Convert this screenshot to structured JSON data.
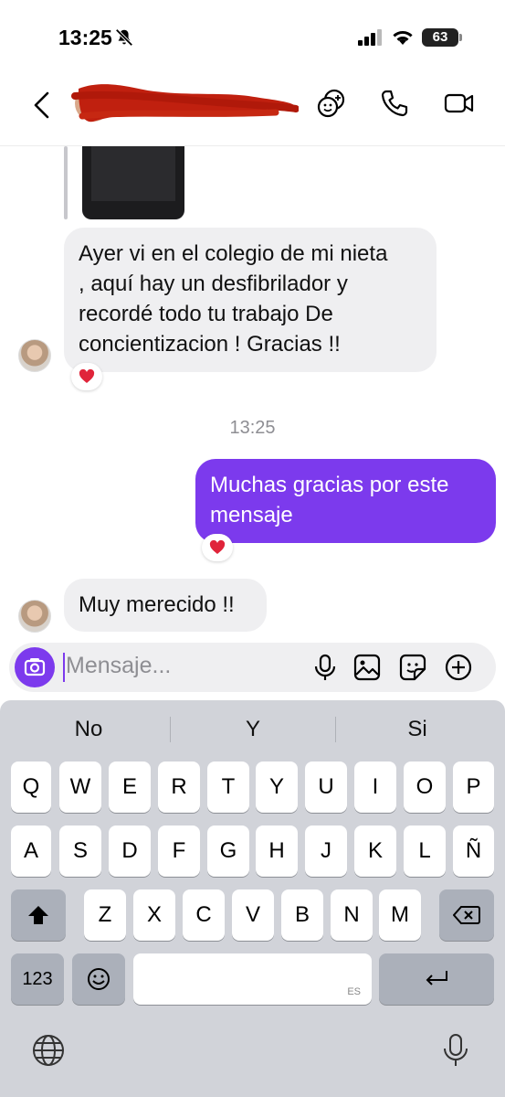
{
  "status_bar": {
    "time": "13:25",
    "battery": "63"
  },
  "header": {
    "contact_name": "",
    "icons": [
      "back-chevron-icon",
      "effects-icon",
      "phone-icon",
      "video-icon"
    ]
  },
  "messages": {
    "m1_lines": [
      "Ayer vi en el colegio de mi nieta",
      ", aquí hay un desfibrilador y",
      "recordé todo tu trabajo  De",
      "concientizacion ! Gracias !!"
    ],
    "m1_reaction": "❤️",
    "timestamp": "13:25",
    "m2_lines": [
      "Muchas gracias por este",
      "mensaje"
    ],
    "m2_reaction": "❤️",
    "m3": "Muy merecido !!"
  },
  "composer": {
    "placeholder": "Mensaje..."
  },
  "keyboard": {
    "suggestions": [
      "No",
      "Y",
      "Si"
    ],
    "row1": [
      "Q",
      "W",
      "E",
      "R",
      "T",
      "Y",
      "U",
      "I",
      "O",
      "P"
    ],
    "row2": [
      "A",
      "S",
      "D",
      "F",
      "G",
      "H",
      "J",
      "K",
      "L",
      "Ñ"
    ],
    "row3": [
      "Z",
      "X",
      "C",
      "V",
      "B",
      "N",
      "M"
    ],
    "numbers_key": "123",
    "emoji_key": "☺",
    "space_lang": "ES"
  },
  "colors": {
    "accent": "#7c3aed",
    "incoming_bubble": "#efeff1",
    "keyboard_bg": "#d1d3d9"
  }
}
